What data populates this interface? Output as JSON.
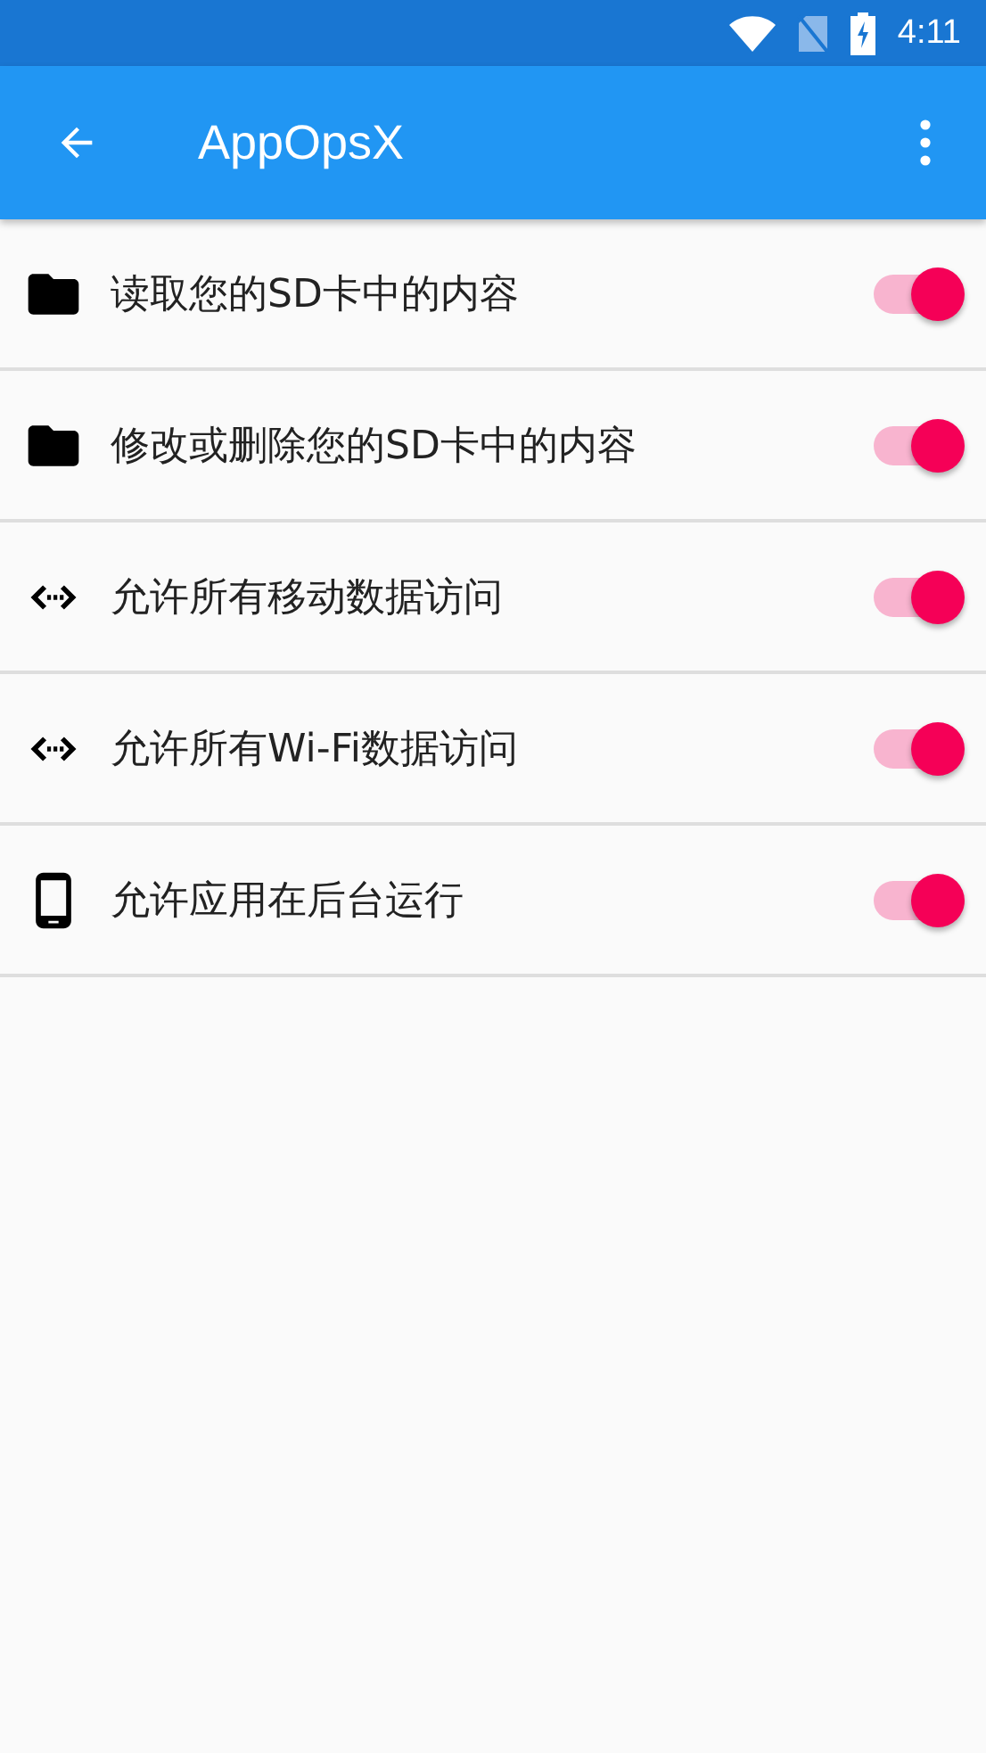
{
  "status_bar": {
    "time": "4:11"
  },
  "app_bar": {
    "title": "AppOpsX"
  },
  "permissions": [
    {
      "kind": "folder",
      "label": "读取您的SD卡中的内容",
      "on": true
    },
    {
      "kind": "folder",
      "label": "修改或删除您的SD卡中的内容",
      "on": true
    },
    {
      "kind": "network",
      "label": "允许所有移动数据访问",
      "on": true
    },
    {
      "kind": "network",
      "label": "允许所有Wi-Fi数据访问",
      "on": true
    },
    {
      "kind": "phone",
      "label": "允许应用在后台运行",
      "on": true
    }
  ]
}
